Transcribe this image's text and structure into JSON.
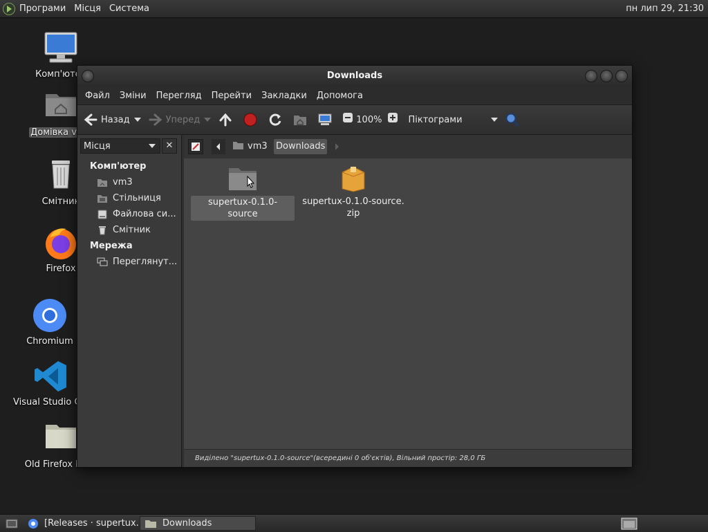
{
  "top_panel": {
    "menus": [
      "Програми",
      "Місця",
      "Система"
    ],
    "clock": "пн лип 29, 21:30"
  },
  "desktop": {
    "icons": [
      {
        "label": "Комп'ютер",
        "icon": "computer-icon"
      },
      {
        "label": "Домівка vm3",
        "icon": "home-folder-icon"
      },
      {
        "label": "Смітник",
        "icon": "trash-icon"
      },
      {
        "label": "Firefox",
        "icon": "firefox-icon"
      },
      {
        "label": "Chromium",
        "icon": "chromium-icon"
      },
      {
        "label": "Visual Studio Code",
        "icon": "vscode-icon"
      },
      {
        "label": "Old Firefox Data",
        "icon": "folder-icon"
      }
    ]
  },
  "window": {
    "title": "Downloads",
    "menu": [
      "Файл",
      "Зміни",
      "Перегляд",
      "Перейти",
      "Закладки",
      "Допомога"
    ],
    "toolbar": {
      "back": "Назад",
      "forward": "Уперед",
      "zoom": "100%",
      "view_mode": "Піктограми"
    },
    "sidebar": {
      "selector": "Місця",
      "close": "✕",
      "section_computer": "Комп'ютер",
      "computer_items": [
        {
          "label": "vm3",
          "icon": "home-icon"
        },
        {
          "label": "Стільниця",
          "icon": "desktop-icon"
        },
        {
          "label": "Файлова си...",
          "icon": "drive-icon"
        },
        {
          "label": "Смітник",
          "icon": "trash-icon"
        }
      ],
      "section_network": "Мережа",
      "network_items": [
        {
          "label": "Переглянут...",
          "icon": "network-icon"
        }
      ]
    },
    "path": {
      "crumbs": [
        "vm3",
        "Downloads"
      ]
    },
    "files": [
      {
        "name": "supertux-0.1.0-source",
        "type": "folder",
        "selected": true
      },
      {
        "name_line1": "supertux-0.1.0-source.",
        "name_line2": "zip",
        "type": "archive",
        "selected": false
      }
    ],
    "status": "Виділено \"supertux-0.1.0-source\"(всередині 0 об'єктів), Вільний простір: 28,0 ГБ"
  },
  "taskbar": {
    "tasks": [
      {
        "label": "[Releases · supertux...",
        "icon": "chromium-icon"
      },
      {
        "label": "Downloads",
        "icon": "folder-icon",
        "active": true
      }
    ]
  },
  "colors": {
    "panel": "#2f2f2f",
    "desktop_bg": "#1e1e1e",
    "content_bg": "#444444",
    "sidebar_bg": "#3a3a3a",
    "folder": "#8a8a8a",
    "archive": "#e6a33a"
  }
}
